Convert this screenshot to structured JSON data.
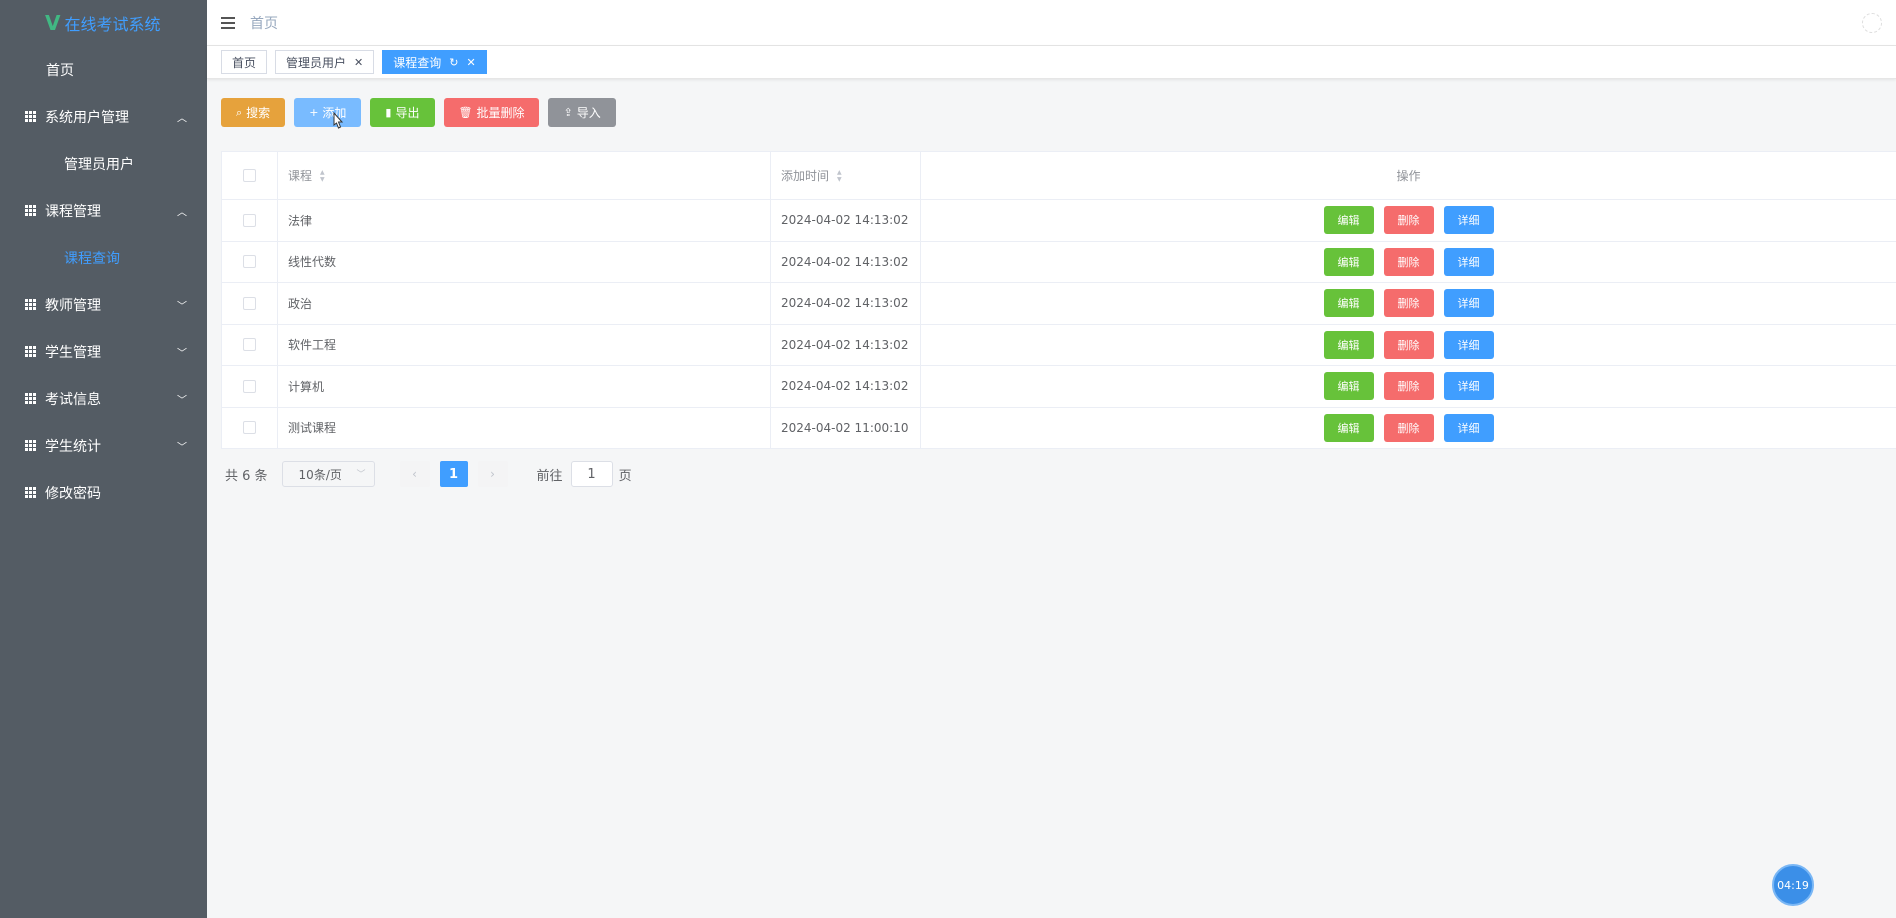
{
  "app": {
    "title": "在线考试系统",
    "logo_letter": "V"
  },
  "sidebar": {
    "home": "首页",
    "groups": [
      {
        "label": "系统用户管理",
        "expanded": true,
        "children": [
          "管理员用户"
        ]
      },
      {
        "label": "课程管理",
        "expanded": true,
        "children": [
          "课程查询"
        ],
        "active_child": "课程查询"
      },
      {
        "label": "教师管理",
        "expanded": false
      },
      {
        "label": "学生管理",
        "expanded": false
      },
      {
        "label": "考试信息",
        "expanded": false
      },
      {
        "label": "学生统计",
        "expanded": false
      }
    ],
    "change_password": "修改密码"
  },
  "header": {
    "breadcrumb": "首页"
  },
  "tabs": [
    {
      "label": "首页",
      "active": false
    },
    {
      "label": "管理员用户",
      "active": false
    },
    {
      "label": "课程查询",
      "active": true
    }
  ],
  "toolbar": {
    "search": "搜索",
    "add": "添加",
    "export": "导出",
    "batch_delete": "批量删除",
    "import": "导入"
  },
  "table": {
    "columns": {
      "course": "课程",
      "time": "添加时间",
      "ops": "操作"
    },
    "rows": [
      {
        "course": "法律",
        "time": "2024-04-02 14:13:02"
      },
      {
        "course": "线性代数",
        "time": "2024-04-02 14:13:02"
      },
      {
        "course": "政治",
        "time": "2024-04-02 14:13:02"
      },
      {
        "course": "软件工程",
        "time": "2024-04-02 14:13:02"
      },
      {
        "course": "计算机",
        "time": "2024-04-02 14:13:02"
      },
      {
        "course": "测试课程",
        "time": "2024-04-02 11:00:10"
      }
    ],
    "ops": {
      "edit": "编辑",
      "delete": "删除",
      "detail": "详细"
    }
  },
  "pagination": {
    "total": "共 6 条",
    "page_size": "10条/页",
    "current": "1",
    "goto_prefix": "前往",
    "goto_value": "1",
    "goto_suffix": "页"
  },
  "timer": "04:19",
  "colors": {
    "sidebar_bg": "#545c64",
    "primary": "#409eff",
    "success": "#67c23a",
    "danger": "#f56c6c",
    "warning": "#e6a23c",
    "info": "#909399"
  }
}
